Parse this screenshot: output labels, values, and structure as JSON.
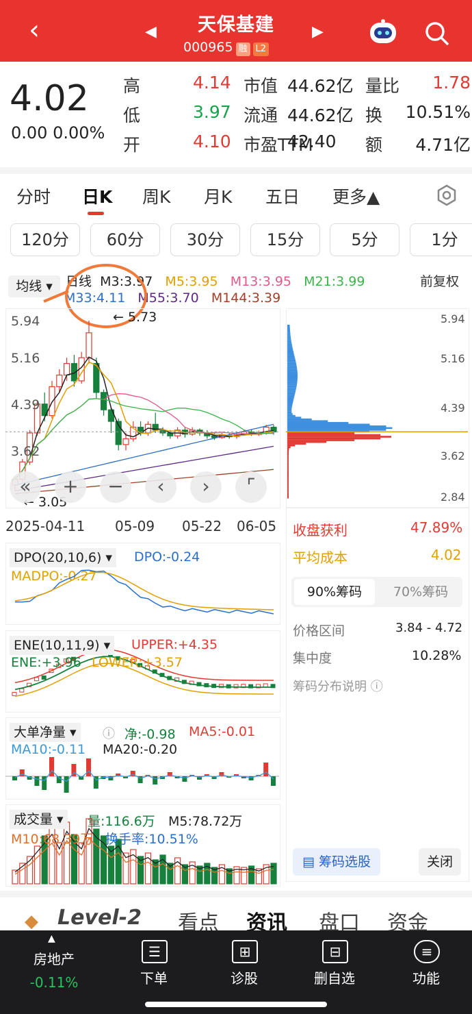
{
  "header": {
    "back": "‹",
    "prev": "◀",
    "next": "▶",
    "title": "天保基建",
    "code": "000965",
    "tag1": "融",
    "tag2": "L2"
  },
  "quote": {
    "price": "4.02",
    "change": "0.00  0.00%",
    "rows": [
      {
        "l1": "高",
        "v1": "4.14",
        "l2": "市值",
        "v2": "44.62亿",
        "l3": "量比",
        "v3": "1.78"
      },
      {
        "l1": "低",
        "v1": "3.97",
        "l2": "流通",
        "v2": "44.62亿",
        "l3": "换",
        "v3": "10.51%"
      },
      {
        "l1": "开",
        "v1": "4.10",
        "l2": "市盈TTM",
        "v2": "42.40",
        "l3": "额",
        "v3": "4.71亿"
      }
    ]
  },
  "tabs": [
    "分时",
    "日K",
    "周K",
    "月K",
    "五日",
    "更多▲"
  ],
  "periods": [
    "120分",
    "60分",
    "30分",
    "15分",
    "5分",
    "1分"
  ],
  "ma": {
    "label": "均线",
    "line": "日线",
    "m3": "M3:3.97",
    "m5": "M5:3.95",
    "m13": "M13:3.95",
    "m21": "M21:3.99",
    "m33": "M33:4.11",
    "m55": "M55:3.70",
    "m144": "M144:3.39",
    "fq": "前复权"
  },
  "kline": {
    "ylabels": [
      "5.94",
      "5.16",
      "4.39",
      "3.62"
    ],
    "high": "5.73",
    "low": "3.05",
    "dates": [
      "2025-04-11",
      "05-09",
      "05-22",
      "06-05"
    ]
  },
  "chips": {
    "ylabels": [
      "5.94",
      "5.16",
      "4.39",
      "3.62",
      "2.84"
    ],
    "profit_label": "收盘获利",
    "profit": "47.89%",
    "cost_label": "平均成本",
    "cost": "4.02",
    "tab1": "90%筹码",
    "tab2": "70%筹码",
    "range_label": "价格区间",
    "range": "3.84 - 4.72",
    "conc_label": "集中度",
    "conc": "10.28%",
    "explain": "筹码分布说明 ⓘ",
    "select": "筹码选股",
    "close": "关闭"
  },
  "dpo": {
    "name": "DPO(20,10,6)",
    "v": "DPO:-0.24",
    "ma": "MADPO:-0.27"
  },
  "ene": {
    "name": "ENE(10,11,9)",
    "upper": "UPPER:+4.35",
    "ene": "ENE:+3.96",
    "lower": "LOWER:+3.57"
  },
  "ddx": {
    "name": "大单净量",
    "net": "净:-0.98",
    "ma5": "MA5:-0.01",
    "ma10": "MA10:-0.11",
    "ma20": "MA20:-0.20"
  },
  "vol": {
    "name": "成交量",
    "v": "量:116.6万",
    "m5": "M5:78.72万",
    "m10": "M10:68.39万",
    "turn": "换手率:10.51%"
  },
  "info_tabs": [
    "Level-2",
    "看点",
    "资讯",
    "盘口",
    "资金"
  ],
  "bottom": {
    "sector": "房地产",
    "sector_chg": "-0.11%",
    "items": [
      "下单",
      "诊股",
      "删自选",
      "功能"
    ]
  },
  "colors": {
    "up": "#e23a33",
    "down": "#16803c",
    "brand": "#e8332f"
  }
}
